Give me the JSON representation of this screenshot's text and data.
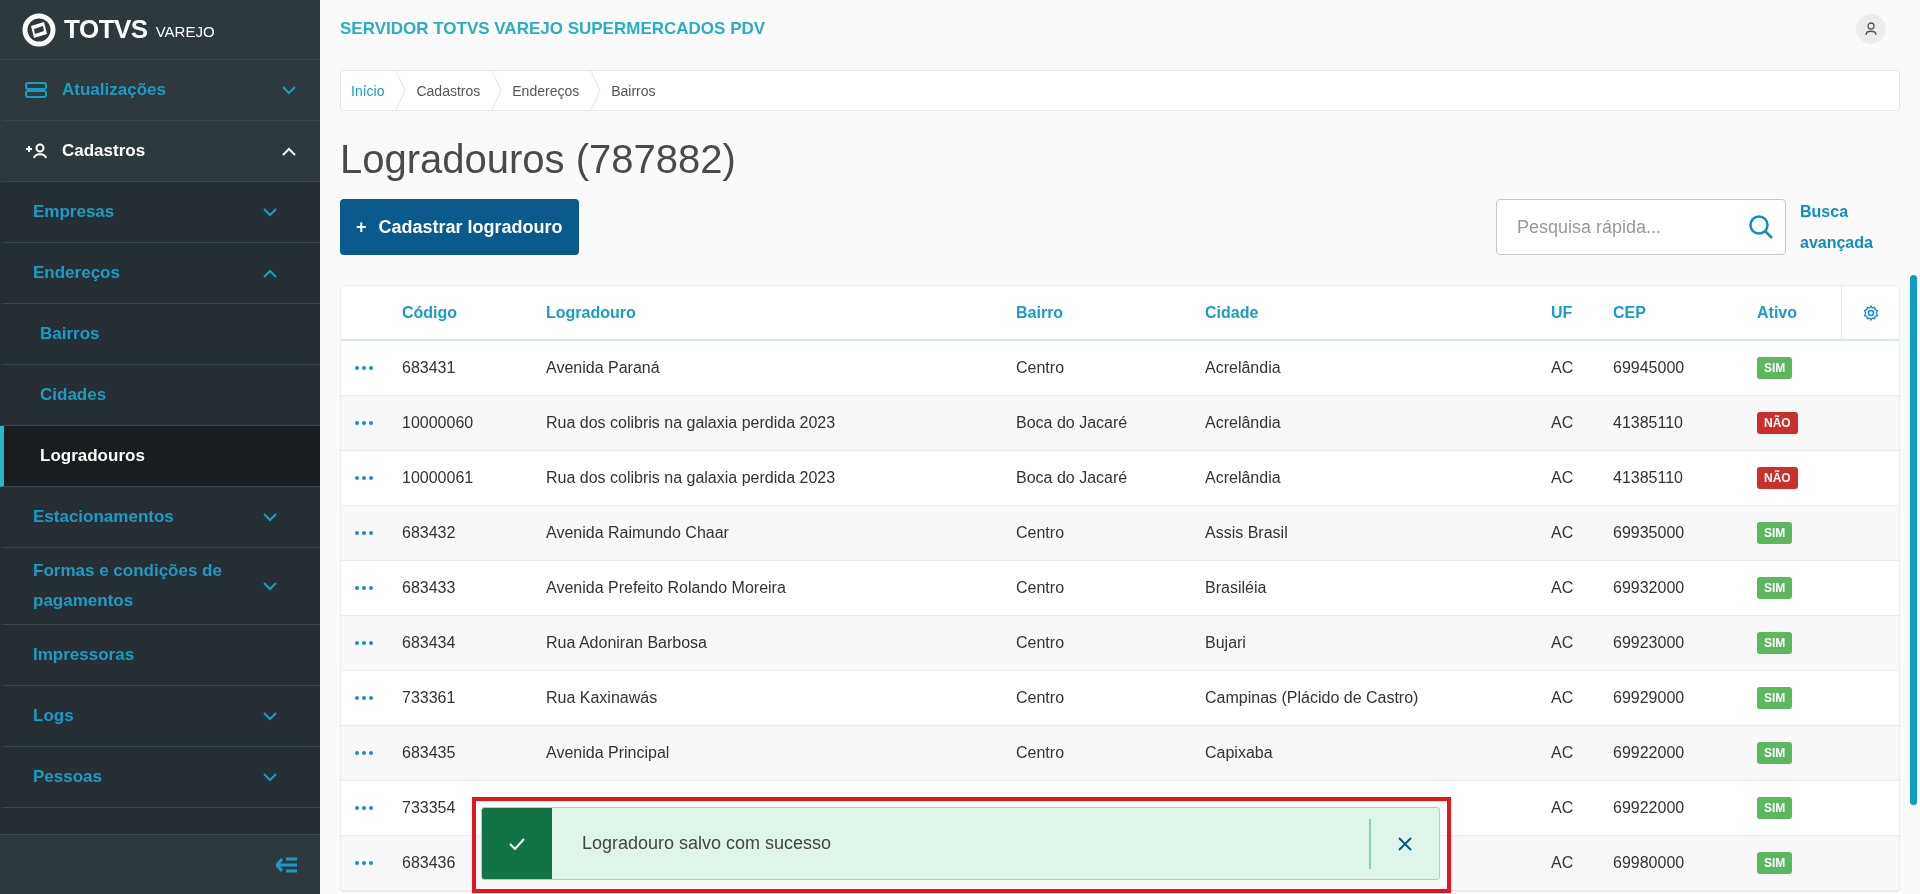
{
  "logo": {
    "name": "TOTVS",
    "suffix": "VAREJO"
  },
  "sidebar": {
    "items": [
      {
        "label": "Atualizações",
        "expanded": false,
        "selected": false
      },
      {
        "label": "Cadastros",
        "expanded": true,
        "selected": false,
        "children": [
          {
            "label": "Empresas",
            "expanded": false,
            "selected": false
          },
          {
            "label": "Endereços",
            "expanded": true,
            "selected": false,
            "children": [
              {
                "label": "Bairros",
                "selected": false
              },
              {
                "label": "Cidades",
                "selected": false
              },
              {
                "label": "Logradouros",
                "selected": true
              }
            ]
          },
          {
            "label": "Estacionamentos",
            "expanded": false,
            "selected": false
          },
          {
            "label": "Formas e condições de pagamentos",
            "expanded": false,
            "selected": false
          },
          {
            "label": "Impressoras",
            "selected": false
          },
          {
            "label": "Logs",
            "expanded": false,
            "selected": false
          },
          {
            "label": "Pessoas",
            "expanded": false,
            "selected": false
          }
        ]
      }
    ]
  },
  "header": {
    "title": "SERVIDOR TOTVS VAREJO SUPERMERCADOS PDV"
  },
  "breadcrumb": [
    {
      "label": "Início",
      "link": true
    },
    {
      "label": "Cadastros",
      "link": false
    },
    {
      "label": "Endereços",
      "link": false
    },
    {
      "label": "Bairros",
      "link": false
    }
  ],
  "page_title": "Logradouros (787882)",
  "add_button": {
    "icon": "+",
    "label": "Cadastrar logradouro"
  },
  "search": {
    "placeholder": "Pesquisa rápida..."
  },
  "advanced_search": "Busca avançada",
  "table": {
    "columns": [
      "Código",
      "Logradouro",
      "Bairro",
      "Cidade",
      "UF",
      "CEP",
      "Ativo"
    ],
    "rows": [
      {
        "codigo": "683431",
        "logradouro": "Avenida Paraná",
        "bairro": "Centro",
        "cidade": "Acrelândia",
        "uf": "AC",
        "cep": "69945000",
        "ativo": {
          "label": "SIM",
          "active": true
        }
      },
      {
        "codigo": "10000060",
        "logradouro": "Rua dos colibris na galaxia perdida 2023",
        "bairro": "Boca do Jacaré",
        "cidade": "Acrelândia",
        "uf": "AC",
        "cep": "41385110",
        "ativo": {
          "label": "NÃO",
          "active": false
        }
      },
      {
        "codigo": "10000061",
        "logradouro": "Rua dos colibris na galaxia perdida 2023",
        "bairro": "Boca do Jacaré",
        "cidade": "Acrelândia",
        "uf": "AC",
        "cep": "41385110",
        "ativo": {
          "label": "NÃO",
          "active": false
        }
      },
      {
        "codigo": "683432",
        "logradouro": "Avenida Raimundo Chaar",
        "bairro": "Centro",
        "cidade": "Assis Brasil",
        "uf": "AC",
        "cep": "69935000",
        "ativo": {
          "label": "SIM",
          "active": true
        }
      },
      {
        "codigo": "683433",
        "logradouro": "Avenida Prefeito Rolando Moreira",
        "bairro": "Centro",
        "cidade": "Brasiléia",
        "uf": "AC",
        "cep": "69932000",
        "ativo": {
          "label": "SIM",
          "active": true
        }
      },
      {
        "codigo": "683434",
        "logradouro": "Rua Adoniran Barbosa",
        "bairro": "Centro",
        "cidade": "Bujari",
        "uf": "AC",
        "cep": "69923000",
        "ativo": {
          "label": "SIM",
          "active": true
        }
      },
      {
        "codigo": "733361",
        "logradouro": "Rua Kaxinawás",
        "bairro": "Centro",
        "cidade": "Campinas (Plácido de Castro)",
        "uf": "AC",
        "cep": "69929000",
        "ativo": {
          "label": "SIM",
          "active": true
        }
      },
      {
        "codigo": "683435",
        "logradouro": "Avenida Principal",
        "bairro": "Centro",
        "cidade": "Capixaba",
        "uf": "AC",
        "cep": "69922000",
        "ativo": {
          "label": "SIM",
          "active": true
        }
      },
      {
        "codigo": "733354",
        "uf": "AC",
        "cep": "69922000",
        "ativo": {
          "label": "SIM",
          "active": true
        }
      },
      {
        "codigo": "683436",
        "uf": "AC",
        "cep": "69980000",
        "ativo": {
          "label": "SIM",
          "active": true
        }
      }
    ]
  },
  "toast": {
    "message": "Logradouro salvo com sucesso",
    "highlighted": true
  }
}
